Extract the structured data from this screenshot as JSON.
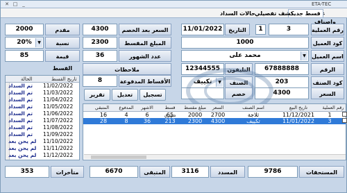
{
  "window": {
    "title": "ETA-TEC",
    "minimize": "_",
    "maximize": "□",
    "close": "✕"
  },
  "tabs": [
    "علاء واصناف",
    "قسط جديد",
    "كشف تفصيلي",
    "حالات السداد"
  ],
  "form": {
    "op_no_label": "رقم العملية",
    "op_no": "3",
    "op_step": "1",
    "date_label": "التاريخ",
    "date": "11/01/2022",
    "price_after_discount_label": "السعر بعد الخصم",
    "price_after_discount": "4300",
    "down_payment_label": "مقدم القسط",
    "down_payment": "2000",
    "client_code_label": "كود العميل",
    "client_code": "1000",
    "remaining_label": "المبلغ المقسط",
    "remaining": "2300",
    "interest_label": "نسبة الفائدة",
    "interest": "20%",
    "client_name_label": "اسم العميل",
    "client_name": "محمد على",
    "months_label": "عدد الشهور",
    "months": "36",
    "installment_value_label": "قيمة القسط",
    "installment_value": "85",
    "national_id_label": "الرقم القومى",
    "national_id": "67888888",
    "phone_label": "التليفون",
    "phone": "12344555",
    "notes_label": "ملاحظات",
    "notes": "",
    "paid_installments_label": "الأقساط المدفوعة",
    "paid_installments": "8",
    "item_code_label": "كود الصنف",
    "item_code": "203",
    "item_label": "الصنف",
    "item": "تكييف",
    "price_label": "السعر",
    "price": "4300",
    "discount_label": "خصم",
    "discount": ""
  },
  "buttons": {
    "save": "تسجيل",
    "edit": "تعديل",
    "report": "تقرير"
  },
  "installments_list": {
    "col_date": "تاريخ القسط",
    "col_status": "الحالة",
    "rows": [
      {
        "date": "11/02/2022",
        "status": "تم السداد"
      },
      {
        "date": "11/03/2022",
        "status": "تم السداد"
      },
      {
        "date": "11/04/2022",
        "status": "تم السداد"
      },
      {
        "date": "11/05/2022",
        "status": "تم السداد"
      },
      {
        "date": "11/06/2022",
        "status": "تم السداد"
      },
      {
        "date": "11/07/2022",
        "status": "تم السداد"
      },
      {
        "date": "11/08/2022",
        "status": "تم السداد"
      },
      {
        "date": "11/09/2022",
        "status": "تم السداد"
      },
      {
        "date": "11/10/2022",
        "status": "لم يحن بعد"
      },
      {
        "date": "11/11/2022",
        "status": "لم يحن بعد"
      },
      {
        "date": "11/12/2022",
        "status": "لم يحن بعد"
      }
    ]
  },
  "grid": {
    "headers": [
      "رقم العملية",
      "تاريخ البيع",
      "اسم الصنف",
      "السعر",
      "مبلغ مقسط",
      "قسط شهري",
      "الاشهر",
      "المدفوع",
      "المتبقي"
    ],
    "rows": [
      {
        "op": "1",
        "date": "11/12/2021",
        "item": "ثلاجة",
        "price": "2700",
        "amount": "2000",
        "monthly": "65",
        "months": "6",
        "paid": "4",
        "remaining": "16"
      },
      {
        "op": "3",
        "date": "11/01/2022",
        "item": "تكييف",
        "price": "4300",
        "amount": "2300",
        "monthly": "213",
        "months": "36",
        "paid": "8",
        "remaining": "28"
      }
    ]
  },
  "footer": {
    "dues_label": "المستحقات",
    "dues": "9786",
    "paid_label": "المسدد",
    "paid": "3116",
    "remaining_label": "المتبقى",
    "remaining": "6670",
    "late_label": "متأخرات",
    "late": "353"
  }
}
